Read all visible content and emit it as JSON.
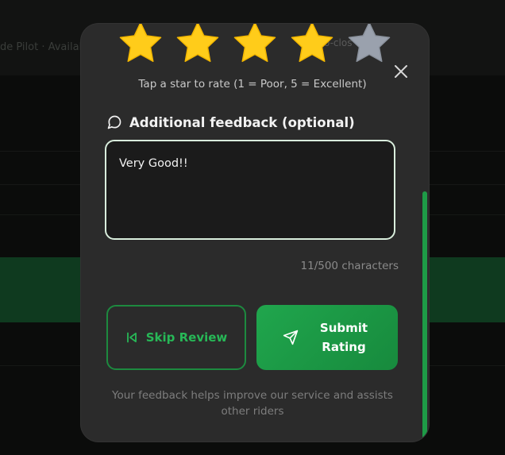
{
  "background": {
    "text": "de Pilot · Available"
  },
  "rating": {
    "stars": [
      {
        "name": "star-1",
        "filled": true
      },
      {
        "name": "star-2",
        "filled": true
      },
      {
        "name": "star-3",
        "filled": true
      },
      {
        "name": "star-4",
        "filled": true
      },
      {
        "name": "star-5",
        "filled": false
      }
    ],
    "value": 4,
    "max": 5,
    "auto_close_text": "ito-clos",
    "hint": "Tap a star to rate (1 = Poor, 5 = Excellent)"
  },
  "feedback": {
    "label": "Additional feedback (optional)",
    "value": "Very Good!!",
    "counter": "11/500 characters"
  },
  "buttons": {
    "skip_label": "Skip Review",
    "submit_line1": "Submit",
    "submit_line2": "Rating"
  },
  "footer": {
    "text": "Your feedback helps improve our service and assists other riders"
  },
  "colors": {
    "star_filled": "#ffcc1a",
    "star_empty": "#9aa1ad",
    "accent": "#1e9b47",
    "modal_bg": "#2b2b2b"
  }
}
